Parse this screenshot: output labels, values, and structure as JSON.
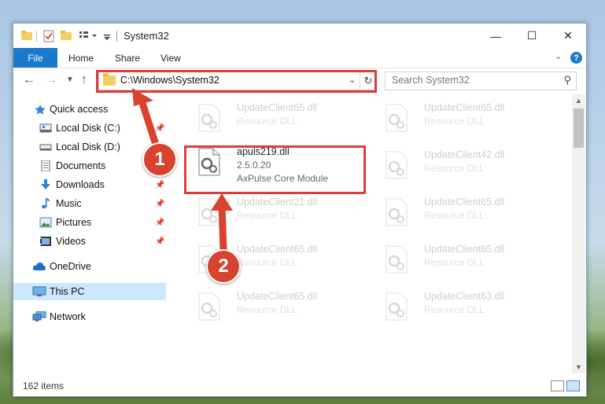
{
  "window": {
    "title": "System32",
    "controls": {
      "minimize": "—",
      "maximize": "☐",
      "close": "✕"
    }
  },
  "ribbon": {
    "file_tab": "File",
    "tabs": [
      "Home",
      "Share",
      "View"
    ],
    "help": "?"
  },
  "nav": {
    "address": "C:\\Windows\\System32",
    "search_placeholder": "Search System32"
  },
  "sidebar": {
    "items": [
      {
        "label": "Quick access",
        "icon": "star-icon",
        "pinned": false
      },
      {
        "label": "Local Disk (C:)",
        "icon": "drive-icon",
        "pinned": true
      },
      {
        "label": "Local Disk (D:)",
        "icon": "drive-icon",
        "pinned": false
      },
      {
        "label": "Documents",
        "icon": "documents-icon",
        "pinned": true
      },
      {
        "label": "Downloads",
        "icon": "download-icon",
        "pinned": true
      },
      {
        "label": "Music",
        "icon": "music-icon",
        "pinned": true
      },
      {
        "label": "Pictures",
        "icon": "pictures-icon",
        "pinned": true
      },
      {
        "label": "Videos",
        "icon": "videos-icon",
        "pinned": true
      },
      {
        "label": "OneDrive",
        "icon": "cloud-icon",
        "pinned": false
      },
      {
        "label": "This PC",
        "icon": "computer-icon",
        "pinned": false,
        "selected": true
      },
      {
        "label": "Network",
        "icon": "network-icon",
        "pinned": false
      }
    ]
  },
  "files": {
    "highlighted": {
      "name": "apuls219.dll",
      "version": "2.5.0.20",
      "description": "AxPulse Core Module"
    },
    "col1": [
      {
        "name": "UpdateClient65.dll",
        "type": "Resource DLL"
      },
      {
        "name": "UpdateClient21.dll",
        "type": "Resource DLL"
      },
      {
        "name": "UpdateClient65.dll",
        "type": "Resource DLL"
      },
      {
        "name": "UpdateClient65.dll",
        "type": "Resource DLL"
      }
    ],
    "col2": [
      {
        "name": "UpdateClient65.dll",
        "type": "Resource DLL"
      },
      {
        "name": "UpdateClient42.dll",
        "type": "Resource DLL"
      },
      {
        "name": "UpdateClient65.dll",
        "type": "Resource DLL"
      },
      {
        "name": "UpdateClient65.dll",
        "type": "Resource DLL"
      },
      {
        "name": "UpdateClient63.dll",
        "type": "Resource DLL"
      }
    ]
  },
  "status": {
    "items": "162 items"
  },
  "annotations": {
    "step1": "1",
    "step2": "2",
    "color": "#dd3c3c"
  }
}
